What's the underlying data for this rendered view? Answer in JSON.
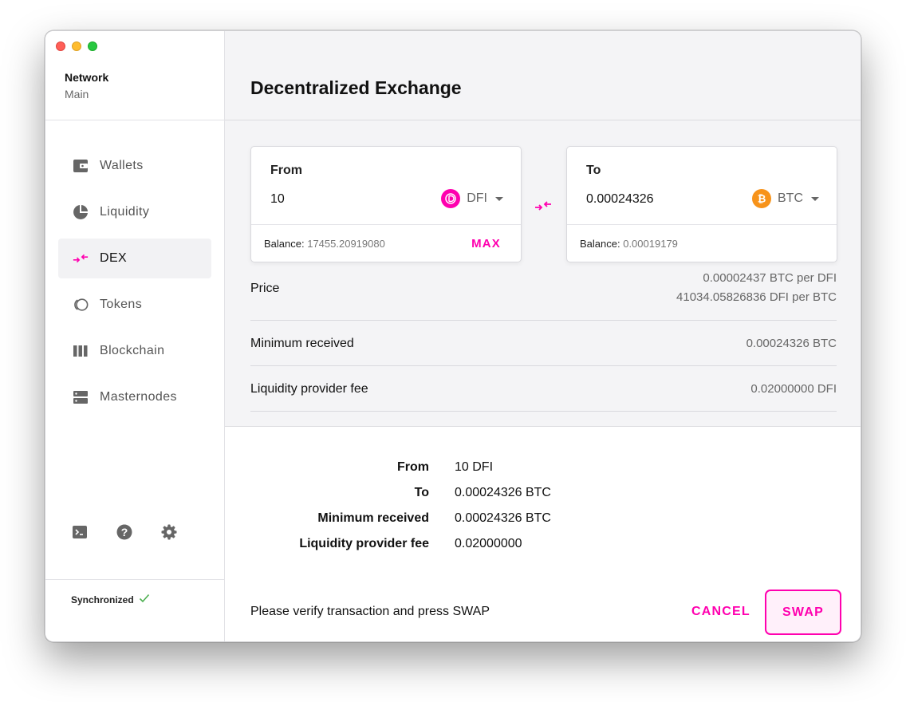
{
  "sidebar": {
    "network_label": "Network",
    "network_value": "Main",
    "items": [
      {
        "label": "Wallets",
        "icon": "wallet-icon"
      },
      {
        "label": "Liquidity",
        "icon": "pie-chart-icon"
      },
      {
        "label": "DEX",
        "icon": "swap-arrows-icon",
        "active": true
      },
      {
        "label": "Tokens",
        "icon": "tokens-icon"
      },
      {
        "label": "Blockchain",
        "icon": "blocks-icon"
      },
      {
        "label": "Masternodes",
        "icon": "server-icon"
      }
    ],
    "tools": [
      "terminal-icon",
      "help-icon",
      "gear-icon"
    ],
    "status": "Synchronized"
  },
  "header": {
    "title": "Decentralized Exchange"
  },
  "from_card": {
    "label": "From",
    "amount": "10",
    "token": "DFI",
    "balance_label": "Balance:",
    "balance_value": "17455.20919080",
    "max_label": "MAX"
  },
  "to_card": {
    "label": "To",
    "amount": "0.00024326",
    "token": "BTC",
    "balance_label": "Balance:",
    "balance_value": "0.00019179"
  },
  "details": {
    "price_label": "Price",
    "price_value_1": "0.00002437 BTC per DFI",
    "price_value_2": "41034.05826836 DFI per BTC",
    "min_received_label": "Minimum received",
    "min_received_value": "0.00024326 BTC",
    "fee_label": "Liquidity provider fee",
    "fee_value": "0.02000000 DFI"
  },
  "summary": [
    {
      "label": "From",
      "value": "10 DFI"
    },
    {
      "label": "To",
      "value": "0.00024326 BTC"
    },
    {
      "label": "Minimum received",
      "value": "0.00024326 BTC"
    },
    {
      "label": "Liquidity provider fee",
      "value": "0.02000000"
    }
  ],
  "footer": {
    "message": "Please verify transaction and press SWAP",
    "cancel_label": "CANCEL",
    "swap_label": "SWAP"
  },
  "colors": {
    "accent": "#ff00af",
    "dfi_coin": "#ff00af",
    "btc_coin": "#f7931a",
    "success": "#4caf50"
  }
}
